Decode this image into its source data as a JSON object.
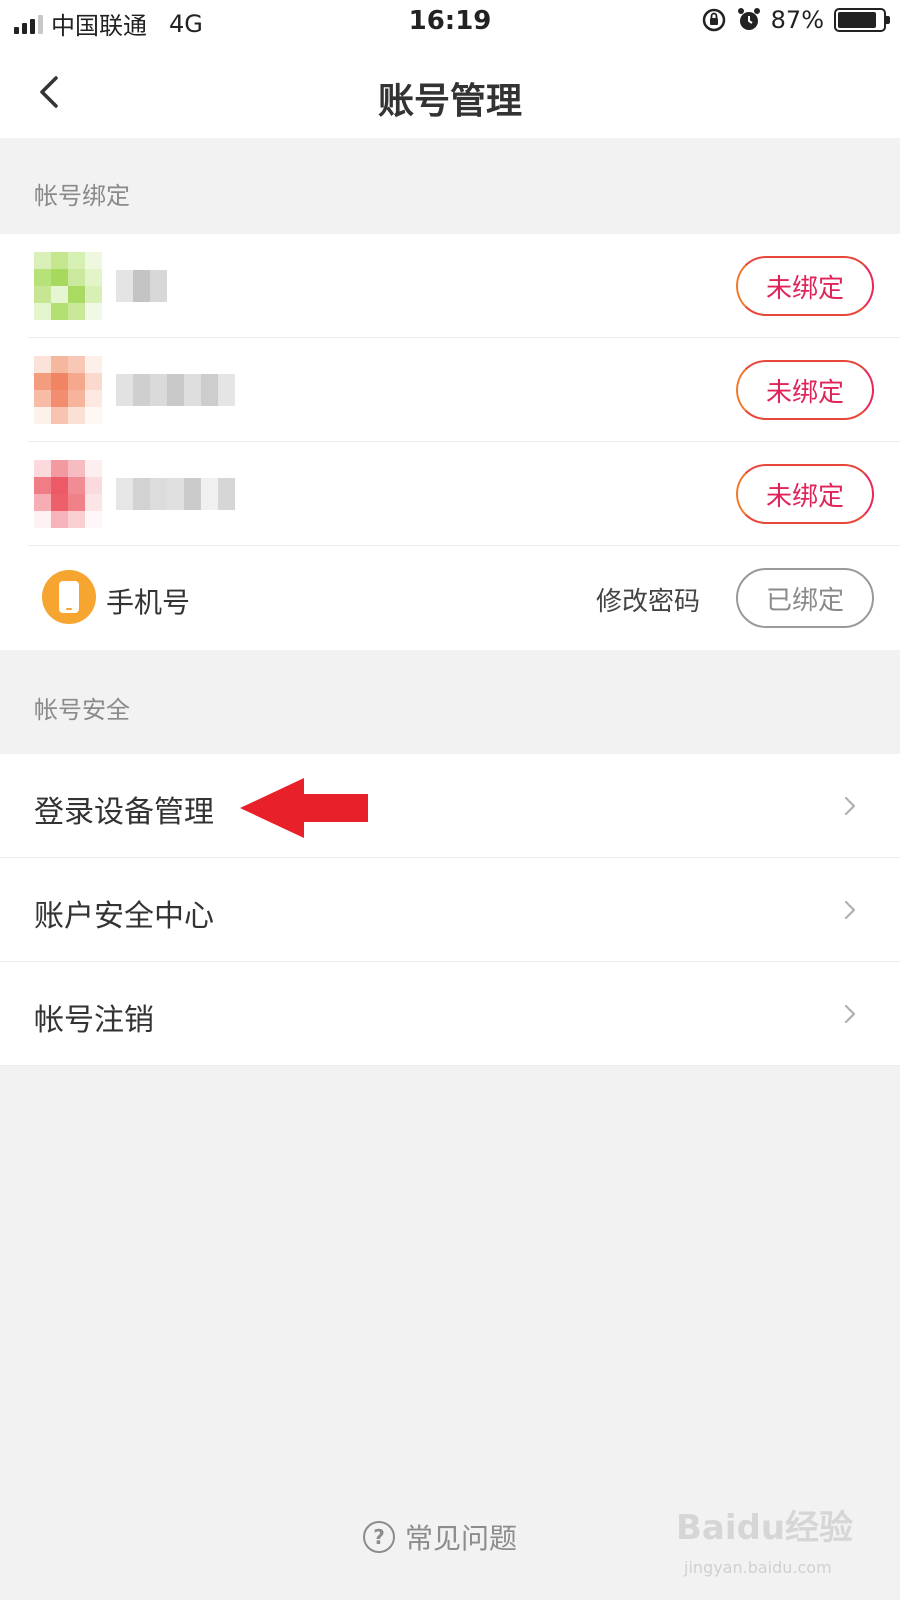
{
  "status_bar": {
    "carrier": "中国联通",
    "network": "4G",
    "time": "16:19",
    "battery": "87%",
    "battery_level": 0.87
  },
  "nav": {
    "title": "账号管理",
    "back_icon": "chevron-left-icon"
  },
  "binding_section": {
    "header": "帐号绑定",
    "accounts": [
      {
        "status": "未绑定"
      },
      {
        "status": "未绑定"
      },
      {
        "status": "未绑定"
      }
    ],
    "phone": {
      "label": "手机号",
      "action": "修改密码",
      "status": "已绑定"
    }
  },
  "security_section": {
    "header": "帐号安全",
    "items": [
      {
        "label": "登录设备管理"
      },
      {
        "label": "账户安全中心"
      },
      {
        "label": "帐号注销"
      }
    ]
  },
  "faq": {
    "label": "常见问题"
  },
  "watermark": {
    "main": "Baidu经验",
    "sub": "jingyan.baidu.com"
  },
  "colors": {
    "accent": "#e0245a",
    "accent_orange": "#f07a2e",
    "phone_icon": "#f7a531",
    "arrow": "#e8202a",
    "background": "#f2f2f2"
  }
}
